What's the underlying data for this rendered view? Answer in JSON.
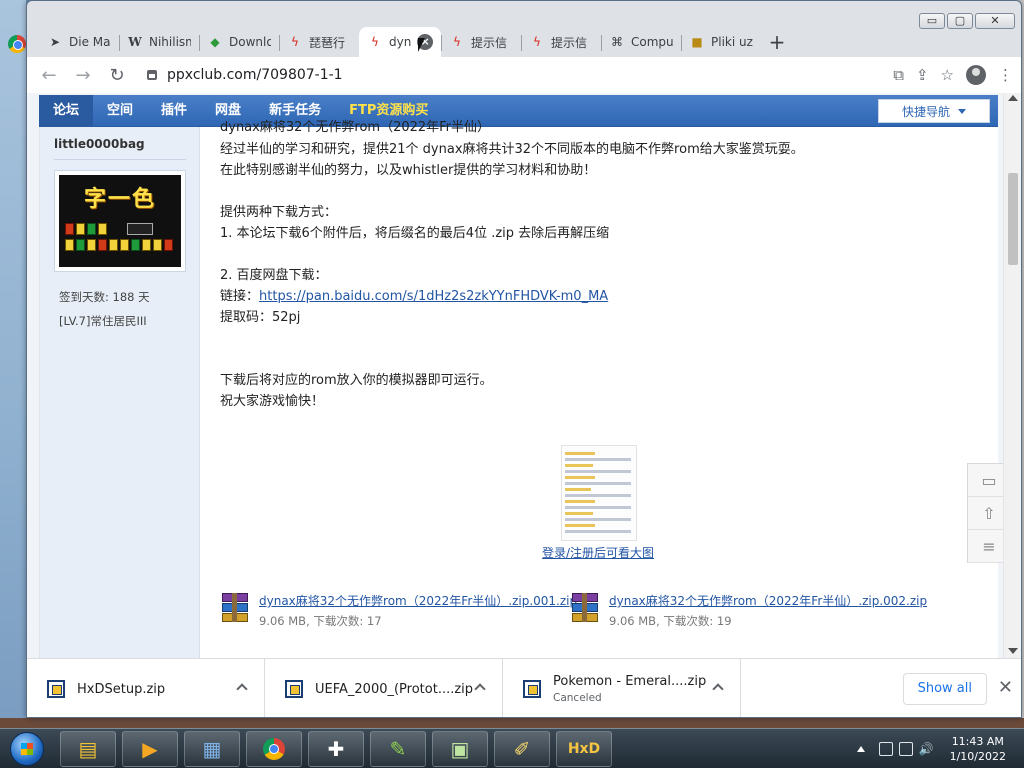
{
  "browser": {
    "tabs": [
      {
        "icon": "bird-icon",
        "label": "Die Ma"
      },
      {
        "icon": "wikipedia-icon",
        "label": "Nihilism"
      },
      {
        "icon": "download-site-icon",
        "label": "Downlo"
      },
      {
        "icon": "ppx-logo-icon",
        "label": "琵琶行"
      },
      {
        "icon": "ppx-logo-icon",
        "label": "dyn",
        "active": true
      },
      {
        "icon": "ppx-logo-icon",
        "label": "提示信"
      },
      {
        "icon": "ppx-logo-icon",
        "label": "提示信"
      },
      {
        "icon": "computer-icon",
        "label": "Compu"
      },
      {
        "icon": "game-icon",
        "label": "Pliki uz"
      }
    ],
    "new_tab_symbol": "+",
    "url": "ppxclub.com/709807-1-1",
    "window_controls": {
      "minimize": "▭",
      "maximize": "▢",
      "close": "✕"
    }
  },
  "site_nav": {
    "items": [
      "论坛",
      "空间",
      "插件",
      "网盘",
      "新手任务",
      "FTP资源购买"
    ],
    "quick_nav": "快捷导航"
  },
  "user": {
    "name": "little0000bag",
    "avatar_title": "字一色",
    "checkin_days": "签到天数: 188 天",
    "level": "[LV.7]常住居民III"
  },
  "post": {
    "line_title": "dynax麻将32个无作弊rom（2022年Fr半仙）",
    "line_intro1": "经过半仙的学习和研究，提供21个 dynax麻将共计32个不同版本的电脑不作弊rom给大家鉴赏玩耍。",
    "line_intro2": "在此特别感谢半仙的努力，以及whistler提供的学习材料和协助！",
    "line_methods": "提供两种下载方式：",
    "line_method1": "1. 本论坛下载6个附件后，将后缀名的最后4位  .zip   去除后再解压缩",
    "line_method2": "2. 百度网盘下载：",
    "link_prefix": "链接：",
    "link_url": "https://pan.baidu.com/s/1dHz2s2zkYYnFHDVK-m0_MA",
    "code": "提取码：52pj",
    "line_run": "下载后将对应的rom放入你的模拟器即可运行。",
    "line_wish": "祝大家游戏愉快！",
    "thumb_link": "登录/注册后可看大图"
  },
  "attachments": [
    {
      "name": "dynax麻将32个无作弊rom（2022年Fr半仙）.zip.001.zip",
      "meta": "9.06 MB, 下载次数: 17"
    },
    {
      "name": "dynax麻将32个无作弊rom（2022年Fr半仙）.zip.002.zip",
      "meta": "9.06 MB, 下载次数: 19"
    }
  ],
  "downloads": [
    {
      "name": "HxDSetup.zip",
      "status": ""
    },
    {
      "name": "UEFA_2000_(Protot....zip",
      "status": ""
    },
    {
      "name": "Pokemon - Emeral....zip",
      "status": "Canceled"
    }
  ],
  "show_all": "Show all",
  "taskbar": {
    "apps": [
      "file-explorer-icon",
      "media-player-icon",
      "control-panel-icon",
      "chrome-icon",
      "gamepad-icon",
      "tool-icon",
      "network-icon",
      "editor-icon",
      "hxd-icon"
    ],
    "time": "11:43 AM",
    "date": "1/10/2022"
  }
}
